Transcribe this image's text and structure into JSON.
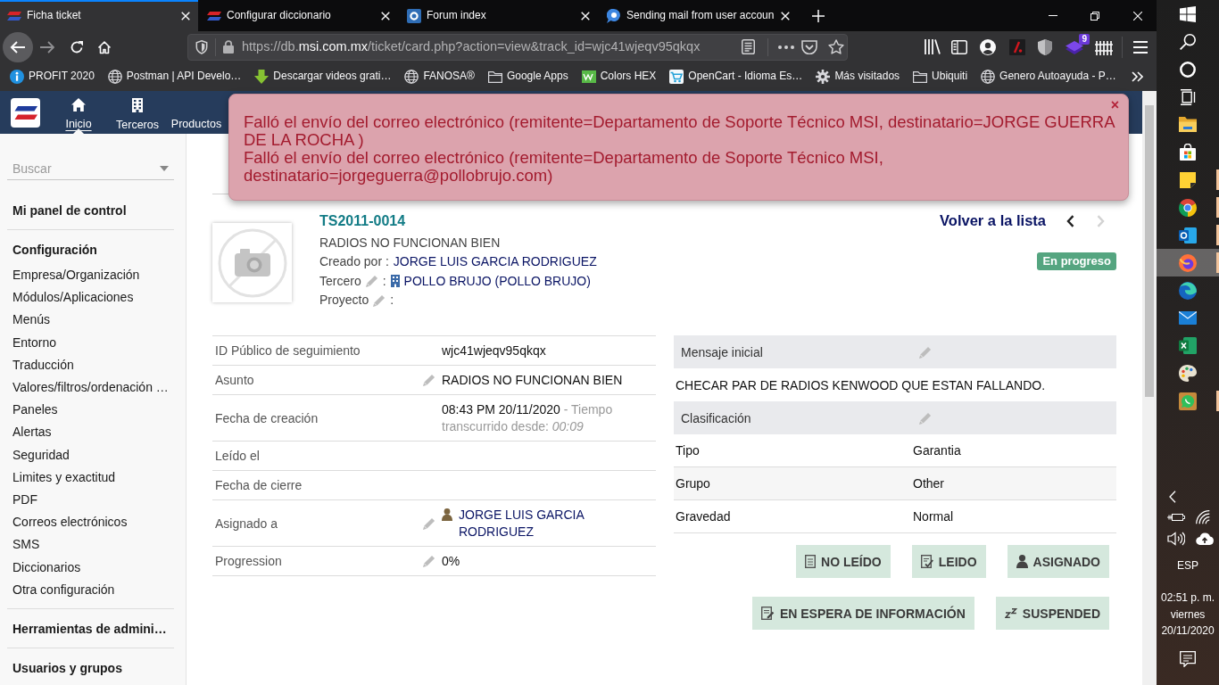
{
  "browser": {
    "tabs": [
      {
        "title": "Ficha ticket",
        "kind": "stripes",
        "selected": true
      },
      {
        "title": "Configurar diccionario",
        "kind": "stripes",
        "selected": false
      },
      {
        "title": "Forum index",
        "kind": "tile",
        "selected": false
      },
      {
        "title": "Sending mail from user accoun",
        "kind": "bubbles",
        "selected": false
      }
    ],
    "address": {
      "prefix": "https://db.",
      "domain": "msi.com.mx",
      "path": "/ticket/card.php?action=view&track_id=wjc41wjeqv95qkqx"
    },
    "extension_badge": "9",
    "bookmarks": [
      {
        "label": "PROFIT 2020",
        "kind": "info"
      },
      {
        "label": "Postman | API Develo…",
        "kind": "globe"
      },
      {
        "label": "Descargar videos grati…",
        "kind": "download"
      },
      {
        "label": "FANOSA®",
        "kind": "globe"
      },
      {
        "label": "Google Apps",
        "kind": "folder"
      },
      {
        "label": "Colors HEX",
        "kind": "swatch"
      },
      {
        "label": "OpenCart - Idioma Es…",
        "kind": "cart"
      },
      {
        "label": "Más visitados",
        "kind": "gear"
      },
      {
        "label": "Ubiquiti",
        "kind": "folder"
      },
      {
        "label": "Genero Autoayuda - P…",
        "kind": "globe"
      }
    ]
  },
  "app": {
    "menu": [
      {
        "label": "Inicio",
        "kind": "home",
        "selected": true
      },
      {
        "label": "Terceros",
        "kind": "building",
        "selected": false
      },
      {
        "label": "Productos",
        "kind": "plain",
        "selected": false
      }
    ],
    "alert": {
      "messages": [
        "Falló el envío del correo electrónico (remitente=Departamento de Soporte Técnico MSI, destinatario=JORGE GUERRA DE LA ROCHA )",
        "Falló el envío del correo electrónico (remitente=Departamento de Soporte Técnico MSI, destinatario=jorgeguerra@pollobrujo.com)"
      ],
      "close": "×"
    },
    "sidebar": {
      "search": {
        "placeholder": "Buscar"
      },
      "sections": [
        {
          "title": "Mi panel de control"
        },
        {
          "title": "Configuración",
          "items": [
            "Empresa/Organización",
            "Módulos/Aplicaciones",
            "Menús",
            "Entorno",
            "Traducción",
            "Valores/filtros/ordenación …",
            "Paneles",
            "Alertas",
            "Seguridad",
            "Limites y exactitud",
            "PDF",
            "Correos electrónicos",
            "SMS",
            "Diccionarios",
            "Otra configuración"
          ]
        },
        {
          "title": "Herramientas de admini…"
        },
        {
          "title": "Usuarios y grupos"
        }
      ]
    },
    "ticket": {
      "ref": "TS2011-0014",
      "subject": "RADIOS NO FUNCIONAN BIEN",
      "lines": [
        {
          "label": "Creado por :",
          "kind": "user",
          "editable": false,
          "value": "JORGE LUIS GARCIA RODRIGUEZ"
        },
        {
          "label": "Tercero",
          "separator": ":",
          "kind": "company",
          "editable": true,
          "value": "POLLO BRUJO (POLLO BRUJO)"
        },
        {
          "label": "Proyecto",
          "separator": ":",
          "editable": true
        }
      ],
      "back_link": "Volver a la lista",
      "prev": {
        "disabled": false
      },
      "next": {
        "disabled": true
      },
      "status": "En progreso"
    },
    "details": [
      {
        "label": "ID Público de seguimiento",
        "kind": "text",
        "editable": false,
        "value": "wjc41wjeqv95qkqx"
      },
      {
        "label": "Asunto",
        "kind": "text",
        "editable": true,
        "value": "RADIOS NO FUNCIONAN BIEN"
      },
      {
        "label": "Fecha de creación",
        "kind": "datetime",
        "editable": false,
        "value": "08:43 PM 20/11/2020",
        "note": "- Tiempo transcurrido desde: *00:09*"
      },
      {
        "label": "Leído el",
        "editable": false
      },
      {
        "label": "Fecha de cierre",
        "editable": false
      },
      {
        "label": "Asignado a",
        "kind": "user",
        "editable": true,
        "value": "JORGE LUIS GARCIA RODRIGUEZ"
      },
      {
        "label": "Progression",
        "kind": "text",
        "editable": true,
        "value": "0%"
      }
    ],
    "message": {
      "title": "Mensaje inicial",
      "editable": true,
      "text": "CHECAR PAR DE RADIOS KENWOOD QUE ESTAN FALLANDO."
    },
    "classification": {
      "title": "Clasificación",
      "editable": true,
      "rows": [
        {
          "label": "Tipo",
          "value": "Garantia"
        },
        {
          "label": "Grupo",
          "value": "Other"
        },
        {
          "label": "Gravedad",
          "value": "Normal"
        }
      ]
    },
    "actions": [
      {
        "label": "NO LEÍDO",
        "kind": "unread"
      },
      {
        "label": "LEIDO",
        "kind": "read"
      },
      {
        "label": "ASIGNADO",
        "kind": "assigned"
      },
      {
        "label": "EN ESPERA DE INFORMACIÓN",
        "kind": "waiting"
      },
      {
        "label": "SUSPENDED",
        "kind": "suspended"
      }
    ]
  },
  "taskbar": {
    "apps": [
      {
        "kind": "folder",
        "selected": false,
        "running": false
      },
      {
        "kind": "bag",
        "selected": false,
        "running": false
      },
      {
        "kind": "note",
        "selected": false,
        "running": true
      },
      {
        "kind": "pinwheel",
        "selected": false,
        "running": true
      },
      {
        "kind": "mail_tile",
        "selected": false,
        "running": true
      },
      {
        "kind": "flame",
        "selected": true,
        "running": true
      },
      {
        "kind": "swirl",
        "selected": false,
        "running": false
      },
      {
        "kind": "envelope",
        "selected": false,
        "running": false
      },
      {
        "kind": "sheet",
        "selected": false,
        "running": false
      },
      {
        "kind": "palette",
        "selected": false,
        "running": false
      },
      {
        "kind": "chat",
        "selected": false,
        "running": true
      }
    ],
    "language": "ESP",
    "clock": {
      "time": "02:51 p. m.",
      "day": "viernes",
      "date": "20/11/2020"
    }
  }
}
